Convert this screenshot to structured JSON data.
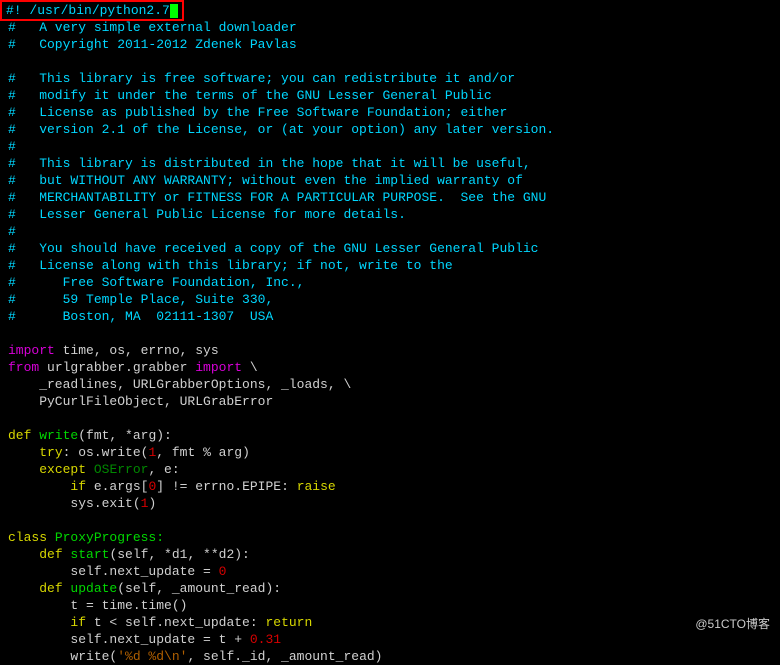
{
  "shebang": "#! /usr/bin/python2.7",
  "comments": [
    "#   A very simple external downloader",
    "#   Copyright 2011-2012 Zdenek Pavlas",
    "",
    "#   This library is free software; you can redistribute it and/or",
    "#   modify it under the terms of the GNU Lesser General Public",
    "#   License as published by the Free Software Foundation; either",
    "#   version 2.1 of the License, or (at your option) any later version.",
    "#",
    "#   This library is distributed in the hope that it will be useful,",
    "#   but WITHOUT ANY WARRANTY; without even the implied warranty of",
    "#   MERCHANTABILITY or FITNESS FOR A PARTICULAR PURPOSE.  See the GNU",
    "#   Lesser General Public License for more details.",
    "#",
    "#   You should have received a copy of the GNU Lesser General Public",
    "#   License along with this library; if not, write to the ",
    "#      Free Software Foundation, Inc., ",
    "#      59 Temple Place, Suite 330, ",
    "#      Boston, MA  02111-1307  USA"
  ],
  "import_kw": "import",
  "from_kw": "from",
  "import_line1_rest": " time, os, errno, sys",
  "from_part": " urlgrabber.grabber ",
  "import_part": " \\",
  "import_cont1": "    _readlines, URLGrabberOptions, _loads, \\",
  "import_cont2": "    PyCurlFileObject, URLGrabError",
  "def_kw": "def",
  "class_kw": "class",
  "try_kw": "try",
  "except_kw": "except",
  "if_kw": "if",
  "raise_kw": "raise",
  "return_kw": "return",
  "write_sig_name": " write",
  "write_sig_params_open": "(",
  "write_sig_params": "fmt, *arg",
  "write_sig_close": "):",
  "try_colon": ": ",
  "os_write": "os.write(",
  "num1": "1",
  "fmt_arg": ", fmt % arg)",
  "except_space": " ",
  "oserror": "OSError",
  "except_e": ", e:",
  "if_indent": "        ",
  "e_args": " e.args[",
  "zero": "0",
  "ne_epipe": "] != errno.EPIPE: ",
  "sys_exit": "        sys.exit(",
  "one": "1",
  "close_paren": ")",
  "class_name": " ProxyProgress:",
  "def_start_name": " start",
  "start_params": "(self, *d1, **d2):",
  "next_update_eq": "        self.next_update = ",
  "zero2": "0",
  "def_update_name": " update",
  "update_params": "(self, _amount_read):",
  "t_time": "        t = time.time()",
  "if_t": "        ",
  "t_lt": " t < self.next_update: ",
  "next_update_t": "        self.next_update = t + ",
  "val031": "0.31",
  "write_call": "        write(",
  "fmt_str": "'%d %d\\n'",
  "write_args": ", self._id, _amount_read)",
  "watermark": "@51CTO博客"
}
